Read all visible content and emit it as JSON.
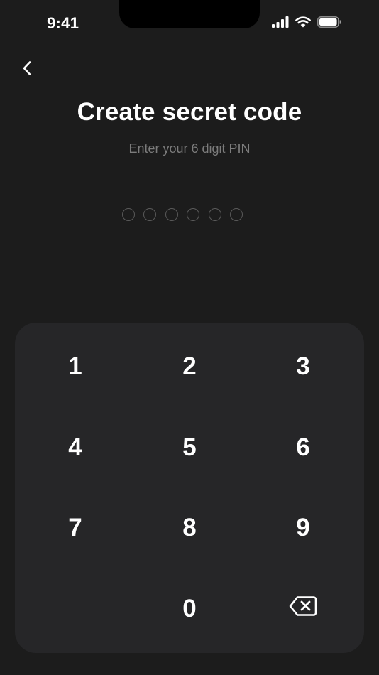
{
  "status_bar": {
    "time": "9:41",
    "icons": [
      "cellular-signal-icon",
      "wifi-icon",
      "battery-icon"
    ]
  },
  "header": {
    "back_icon": "chevron-left-icon",
    "title": "Create secret code",
    "subtitle": "Enter your 6 digit PIN"
  },
  "pin": {
    "length": 6,
    "filled": 0
  },
  "keypad": {
    "keys": [
      "1",
      "2",
      "3",
      "4",
      "5",
      "6",
      "7",
      "8",
      "9",
      "0"
    ],
    "delete_icon": "backspace-icon"
  },
  "colors": {
    "background": "#1c1c1c",
    "keypad_background": "#262628",
    "subtitle": "#7c7c7c",
    "dot_outline": "#5a5a5a",
    "text": "#ffffff"
  }
}
